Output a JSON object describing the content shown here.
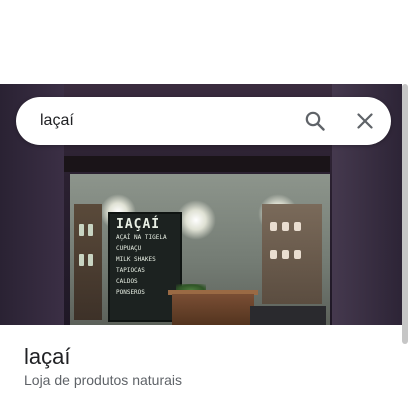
{
  "search": {
    "query": "laçaí"
  },
  "icons": {
    "search": "search-icon",
    "close": "close-icon"
  },
  "photo": {
    "board_title": "IAÇAÍ",
    "board_lines": [
      "AÇAÍ NA TIGELA",
      "CUPUAÇU",
      "MILK SHAKES",
      "TAPIOCAS",
      "CALDOS",
      "PONSEROS"
    ]
  },
  "place": {
    "name": "laçaí",
    "category": "Loja de produtos naturais"
  },
  "colors": {
    "text_primary": "#202124",
    "text_secondary": "#5f6368",
    "icon": "#5f6368"
  }
}
